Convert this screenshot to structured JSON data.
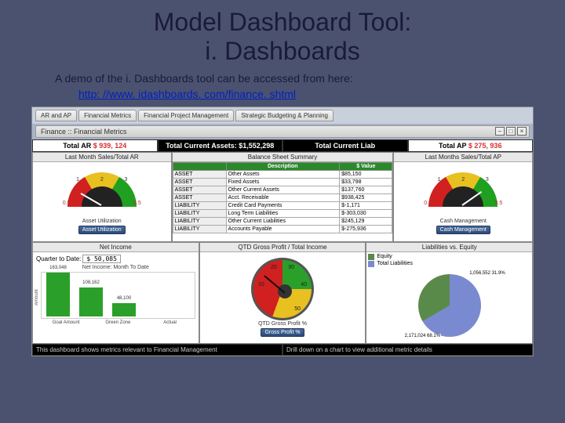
{
  "slide": {
    "title_l1": "Model Dashboard Tool:",
    "title_l2": "i. Dashboards",
    "subtitle": "A demo of the i. Dashboards tool can be accessed from here:",
    "link": "http: //www. idashboards. com/finance. shtml"
  },
  "tabs": [
    "AR and AP",
    "Financial Metrics",
    "Financial Project Management",
    "Strategic Budgeting & Planning"
  ],
  "panel_title": "Finance :: Financial Metrics",
  "kpi": {
    "ar_label": "Total AR",
    "ar_value": "$ 939, 124",
    "assets_label": "Total Current Assets:",
    "assets_value": "$1,552,298",
    "liab_label_short": "Total Current Liab",
    "ap_label": "Total AP",
    "ap_value": "$ 275, 936"
  },
  "mid_headers": {
    "left": "Last Month Sales/Total AR",
    "center": "Balance Sheet Summary",
    "right": "Last Months Sales/Total AP"
  },
  "gauge_left": {
    "ticks": [
      "1",
      "2",
      "3"
    ],
    "side_lo": "0.5",
    "side_hi": "3.5",
    "caption": "Asset Utilization",
    "button": "Asset Utilization"
  },
  "gauge_right": {
    "ticks": [
      "1",
      "2",
      "3"
    ],
    "side_lo": "0.5",
    "side_hi": "3.5",
    "caption": "Cash Management",
    "button": "Cash Management"
  },
  "balance_sheet": {
    "cols": [
      "",
      "Description",
      "$ Value"
    ],
    "rows": [
      [
        "ASSET",
        "Other Assets",
        "$85,150"
      ],
      [
        "ASSET",
        "Fixed Assets",
        "$33,798"
      ],
      [
        "ASSET",
        "Other Current Assets",
        "$137,760"
      ],
      [
        "ASSET",
        "Acct. Receivable",
        "$938,425"
      ],
      [
        "LIABILITY",
        "Credit Card Payments",
        "$-1,171"
      ],
      [
        "LIABILITY",
        "Long Term Liabilities",
        "$-303,030"
      ],
      [
        "LIABILITY",
        "Other Current Liabilities",
        "$245,129"
      ],
      [
        "LIABILITY",
        "Accounts Payable",
        "$-275,936"
      ]
    ]
  },
  "bot_headers": {
    "left": "Net Income",
    "center": "QTD Gross Profit / Total Income",
    "right": "Liabilities vs. Equity"
  },
  "net_income": {
    "qtd_label": "Quarter to Date:",
    "qtd_value": "$   50,085",
    "mini_title": "Net Income: Month To Date",
    "ylabel": "Amount"
  },
  "chart_data": {
    "type": "bar",
    "categories": [
      "Goal Amount",
      "Green Zone",
      "Actual"
    ],
    "values": [
      163048,
      108162,
      48100
    ],
    "title": "Net Income: Month To Date",
    "ylabel": "Amount",
    "ylim": [
      0,
      170000
    ]
  },
  "circ_gauge": {
    "ticks": [
      "10",
      "20",
      "30",
      "40",
      "50"
    ],
    "caption": "QTD Gross Profit %",
    "button": "Gross Profit %",
    "value_pct": 23
  },
  "pie": {
    "legend": [
      {
        "name": "Equity",
        "color": "#5a8a4a"
      },
      {
        "name": "Total Liabilities",
        "color": "#7a8ad0"
      }
    ],
    "slices": [
      {
        "label": "1,056,552",
        "pct": 31.9,
        "color": "#5a8a4a"
      },
      {
        "label": "2,171,024",
        "pct": 68.1,
        "color": "#7a8ad0"
      }
    ]
  },
  "footer": {
    "left": "This dashboard shows metrics relevant to Financial Management",
    "right": "Drill down on a chart to view additional metric details"
  }
}
